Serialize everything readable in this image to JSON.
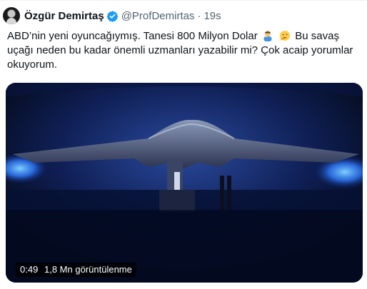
{
  "tweet": {
    "display_name": "Özgür Demirtaş",
    "handle": "@ProfDemirtas",
    "separator": "·",
    "time": "19s",
    "text_lines": [
      "ABD’nin yeni oyuncağıymış. Tanesi 800 Milyon Dolar",
      "uçağı neden bu kadar önemli uzmanları yazabilir mi? Çok acaip yorumlar",
      "okuyorum."
    ],
    "text_line1_tail": "Bu savaş",
    "emojis": [
      "man-facepalming-emoji",
      "thinking-face-emoji"
    ]
  },
  "video": {
    "duration": "0:49",
    "views": "1,8 Mn görüntülenme"
  },
  "colors": {
    "verified": "#1d9bf0",
    "secondary_text": "#536471",
    "hangar_light": "#2f7bff"
  }
}
